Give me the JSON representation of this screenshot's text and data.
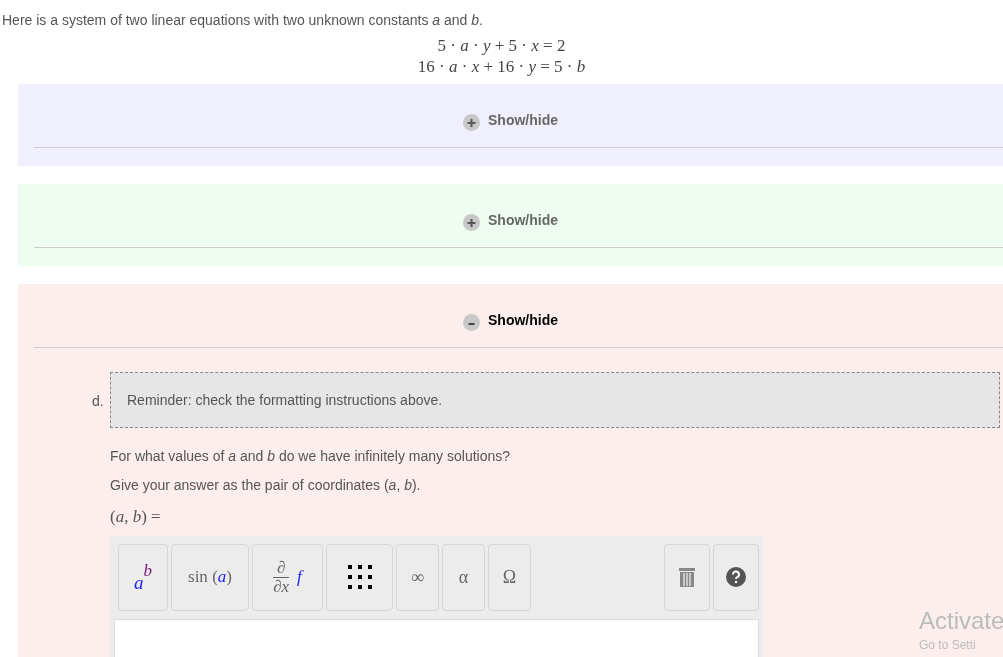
{
  "intro": "Here is a system of two linear equations with two unknown constants *a* and *b*.",
  "equations": [
    "5 · *a* · *y* + 5 · *x* = 2",
    "16 · *a* · *x* + 16 · *y* = 5 · *b*"
  ],
  "panels": [
    {
      "color": "#efeffd",
      "expanded": false,
      "toggle": "Show/hide"
    },
    {
      "color": "#effdf0",
      "expanded": false,
      "toggle": "Show/hide"
    },
    {
      "color": "#fdeeee",
      "expanded": true,
      "toggle": "Show/hide",
      "part": "d.",
      "reminder": "Reminder: check the formatting instructions above.",
      "questions": [
        "For what values of *a* and *b* do we have infinitely many solutions?",
        "Give your answer as the pair of coordinates (*a*, *b*)."
      ],
      "answer_label": "(*a*, *b*) =",
      "toolbar": [
        {
          "kind": "power",
          "base": "a",
          "exponent": "b"
        },
        {
          "kind": "function",
          "name": "sin",
          "open": "(",
          "arg": "a",
          "close": ")"
        },
        {
          "kind": "derivative",
          "numerator": "∂",
          "denominator": "∂x",
          "func": "f"
        },
        {
          "kind": "matrix"
        },
        {
          "kind": "symbol",
          "label": "∞"
        },
        {
          "kind": "symbol",
          "label": "α"
        },
        {
          "kind": "symbol",
          "label": "Ω"
        }
      ]
    }
  ],
  "watermark": [
    "Activate",
    "Go to Setti"
  ]
}
